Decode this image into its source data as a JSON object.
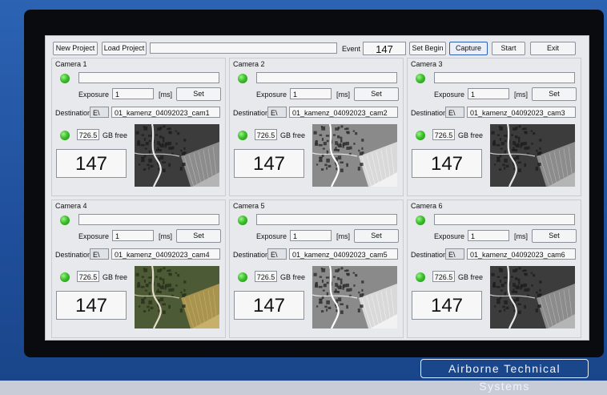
{
  "toolbar": {
    "new_project": "New Project",
    "load_project": "Load Project",
    "project_path": "",
    "event_label": "Event",
    "event_value": "147",
    "set_begin": "Set Begin",
    "capture": "Capture",
    "start": "Start",
    "exit": "Exit"
  },
  "brand": "Airborne   Technical   Systems",
  "cameras": [
    {
      "title": "Camera 1",
      "exposure_label": "Exposure",
      "exposure": "1",
      "unit": "[ms]",
      "set": "Set",
      "dest_label": "Destination",
      "drive": "E\\",
      "dest": "01_kamenz_04092023_cam1",
      "gb": "726.5",
      "gb_label": "GB free",
      "count": "147",
      "tone": "mono-dark"
    },
    {
      "title": "Camera 2",
      "exposure_label": "Exposure",
      "exposure": "1",
      "unit": "[ms]",
      "set": "Set",
      "dest_label": "Destination",
      "drive": "E\\",
      "dest": "01_kamenz_04092023_cam2",
      "gb": "726.5",
      "gb_label": "GB free",
      "count": "147",
      "tone": "mono-bright"
    },
    {
      "title": "Camera 3",
      "exposure_label": "Exposure",
      "exposure": "1",
      "unit": "[ms]",
      "set": "Set",
      "dest_label": "Destination",
      "drive": "E\\",
      "dest": "01_kamenz_04092023_cam3",
      "gb": "726.5",
      "gb_label": "GB free",
      "count": "147",
      "tone": "mono-dark"
    },
    {
      "title": "Camera 4",
      "exposure_label": "Exposure",
      "exposure": "1",
      "unit": "[ms]",
      "set": "Set",
      "dest_label": "Destination",
      "drive": "E\\",
      "dest": "01_kamenz_04092023_cam4",
      "gb": "726.5",
      "gb_label": "GB free",
      "count": "147",
      "tone": "color"
    },
    {
      "title": "Camera 5",
      "exposure_label": "Exposure",
      "exposure": "1",
      "unit": "[ms]",
      "set": "Set",
      "dest_label": "Destination",
      "drive": "E\\",
      "dest": "01_kamenz_04092023_cam5",
      "gb": "726.5",
      "gb_label": "GB free",
      "count": "147",
      "tone": "mono-bright"
    },
    {
      "title": "Camera 6",
      "exposure_label": "Exposure",
      "exposure": "1",
      "unit": "[ms]",
      "set": "Set",
      "dest_label": "Destination",
      "drive": "E\\",
      "dest": "01_kamenz_04092023_cam6",
      "gb": "726.5",
      "gb_label": "GB free",
      "count": "147",
      "tone": "mono-dark"
    }
  ],
  "colors": {
    "bezel": "#0a0b0e",
    "device": "#2c63b3",
    "led": "#3cc12b",
    "capture_border": "#2f5fb3"
  }
}
